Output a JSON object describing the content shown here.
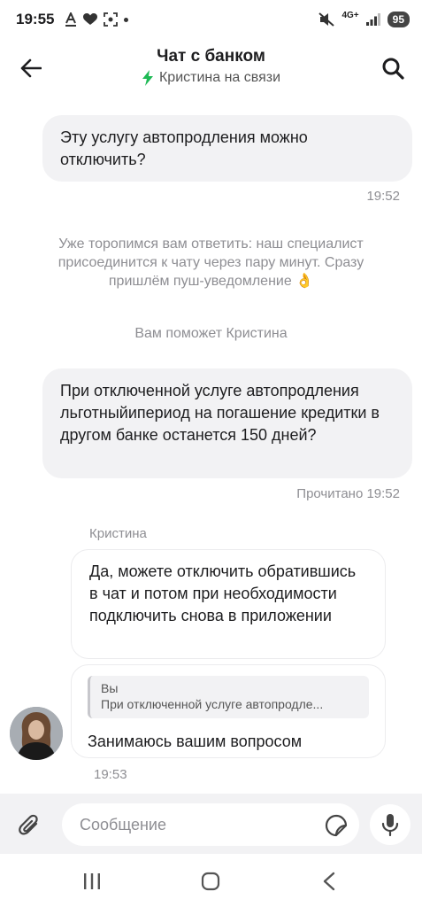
{
  "status_bar": {
    "time": "19:55",
    "network": "4G+",
    "battery": "95"
  },
  "header": {
    "title": "Чат с банком",
    "subtitle": "Кристина на связи",
    "accent_color": "#1db954"
  },
  "messages": {
    "out1": {
      "text": "Эту услугу автопродления можно отключить?",
      "time": "19:52"
    },
    "system1": "Уже торопимся вам ответить: наш специалист присоединится к чату через пару минут. Сразу пришлём пуш-уведомление 👌",
    "system2": "Вам поможет Кристина",
    "out2": {
      "text": "При отключенной услуге автопродления льготныйипериод на погашение кредитки в другом банке останется 150 дней?",
      "status": "Прочитано 19:52"
    },
    "operator_name": "Кристина",
    "in1": {
      "text": "Да, можете отключить обратившись в чат и потом при необходимости подключить снова в приложении"
    },
    "in2": {
      "quote_author": "Вы",
      "quote_text": "При отключенной услуге автопродле...",
      "text": "Занимаюсь вашим вопросом",
      "time": "19:53"
    }
  },
  "input": {
    "placeholder": "Сообщение",
    "value": ""
  },
  "icons": {
    "back": "arrow-left-icon",
    "search": "search-icon",
    "online": "lightning-icon",
    "attach": "paperclip-icon",
    "sticker": "sticker-icon",
    "mic": "microphone-icon",
    "nav_recent": "recent-apps-icon",
    "nav_home": "home-icon",
    "nav_back": "chevron-left-icon"
  }
}
